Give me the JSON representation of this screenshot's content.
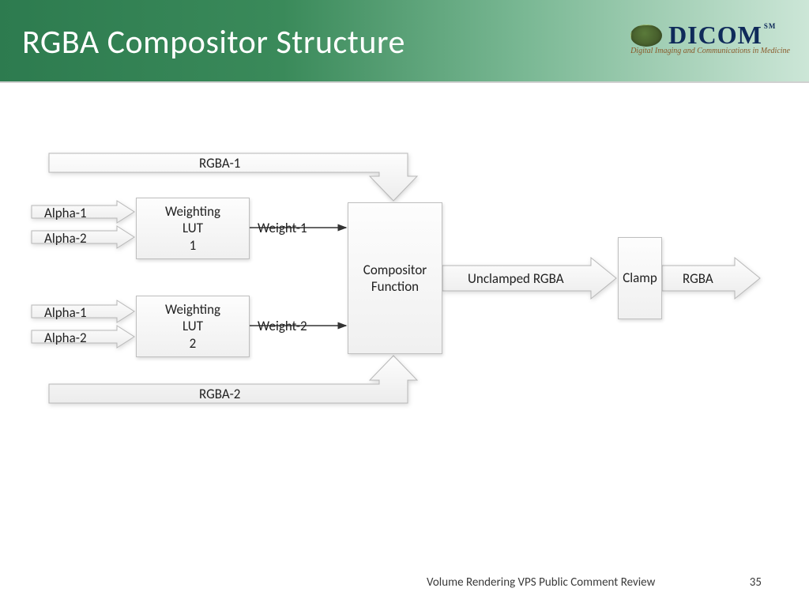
{
  "header": {
    "title": "RGBA Compositor Structure",
    "logo_word": "DICOM",
    "logo_sm": "SM",
    "tagline": "Digital Imaging and Communications in Medicine"
  },
  "diagram": {
    "rgba1": "RGBA-1",
    "rgba2": "RGBA-2",
    "alpha1": "Alpha-1",
    "alpha2": "Alpha-2",
    "lut1": "Weighting\nLUT\n1",
    "lut2": "Weighting\nLUT\n2",
    "weight1": "Weight-1",
    "weight2": "Weight-2",
    "compositor": "Compositor\nFunction",
    "unclamped": "Unclamped RGBA",
    "clamp": "Clamp",
    "rgba_out": "RGBA"
  },
  "footer": {
    "text": "Volume Rendering VPS Public Comment Review",
    "page": "35"
  }
}
